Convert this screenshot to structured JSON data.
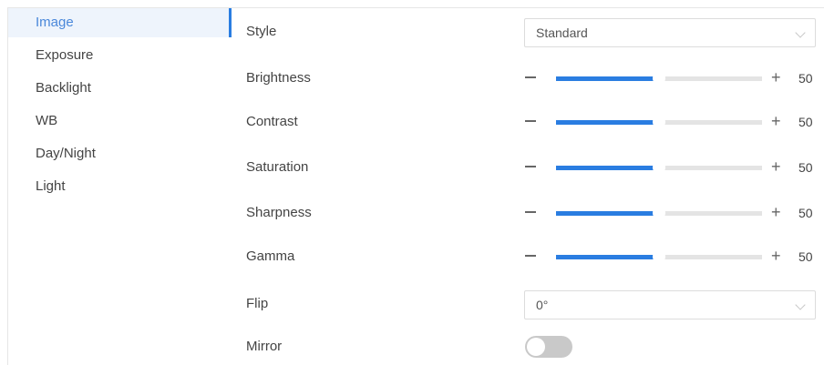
{
  "sidebar": {
    "items": [
      {
        "label": "Image"
      },
      {
        "label": "Exposure"
      },
      {
        "label": "Backlight"
      },
      {
        "label": "WB"
      },
      {
        "label": "Day/Night"
      },
      {
        "label": "Light"
      }
    ],
    "active_index": 0
  },
  "settings": {
    "style": {
      "label": "Style",
      "value": "Standard"
    },
    "brightness": {
      "label": "Brightness",
      "value": "50",
      "level": 0.5
    },
    "contrast": {
      "label": "Contrast",
      "value": "50",
      "level": 0.5
    },
    "saturation": {
      "label": "Saturation",
      "value": "50",
      "level": 0.5
    },
    "sharpness": {
      "label": "Sharpness",
      "value": "50",
      "level": 0.5
    },
    "gamma": {
      "label": "Gamma",
      "value": "50",
      "level": 0.5
    },
    "flip": {
      "label": "Flip",
      "value": "0°"
    },
    "mirror": {
      "label": "Mirror",
      "on": false
    }
  },
  "controls": {
    "minus_icon": "minus-icon",
    "plus_icon": "plus-icon",
    "plus_glyph": "+"
  },
  "colors": {
    "accent": "#2a7de1",
    "active_bg": "#eef4fc",
    "track": "#e4e4e4",
    "toggle_off": "#c9c9c9"
  }
}
